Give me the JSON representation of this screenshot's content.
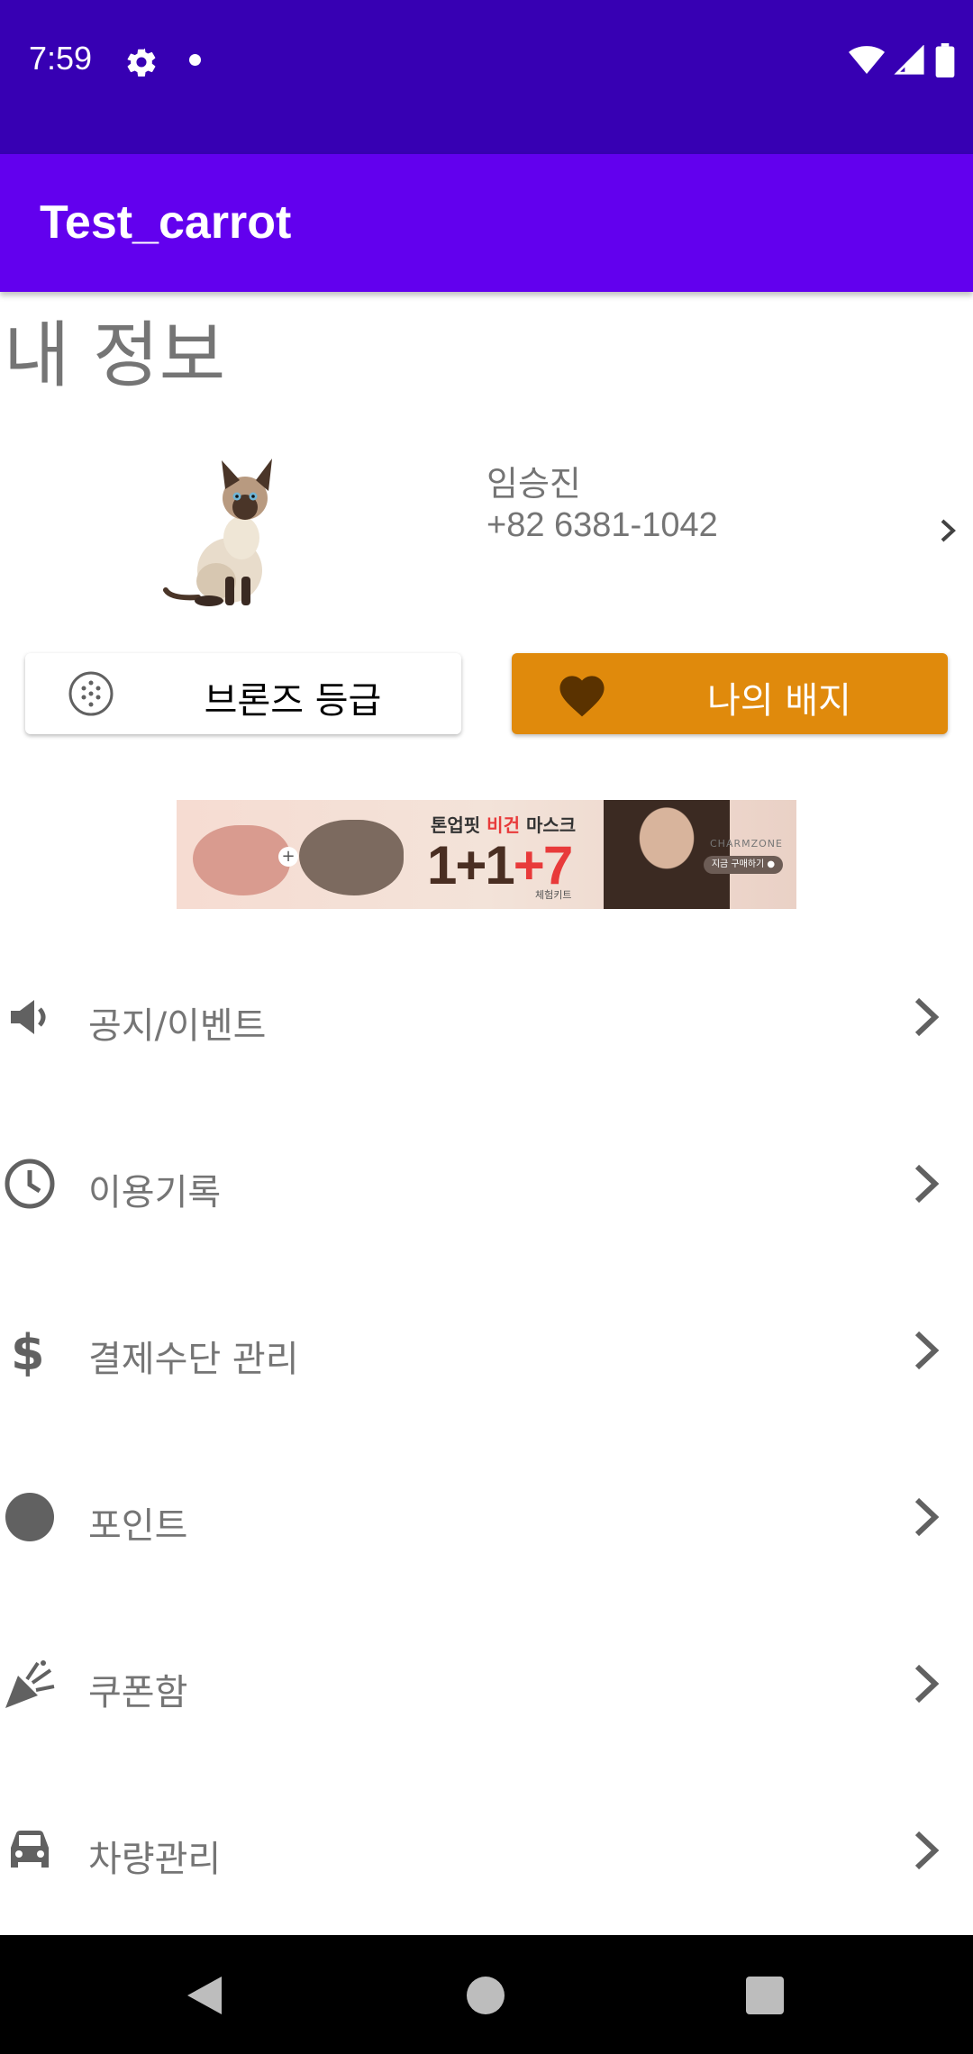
{
  "status_bar": {
    "time": "7:59",
    "icons": [
      "gear-icon",
      "notification-dot-icon",
      "wifi-icon",
      "signal-icon",
      "battery-icon"
    ]
  },
  "app_bar": {
    "title": "Test_carrot"
  },
  "page": {
    "title": "내 정보"
  },
  "profile": {
    "name": "임승진",
    "phone": "+82 6381-1042",
    "image": "cat-photo"
  },
  "actions": {
    "grade_label": "브론즈 등급",
    "badge_label": "나의 배지",
    "badge_color": "#e08a0c"
  },
  "ad": {
    "headline_part1": "톤업핏 ",
    "headline_accent": "비건",
    "headline_part2": " 마스크",
    "big_text": "1+1",
    "big_accent": "+7",
    "sub_text": "체험키트",
    "brand": "CHARMZONE",
    "cta": "지금 구매하기 ●"
  },
  "menu": {
    "items": [
      {
        "label": "공지/이벤트",
        "icon": "megaphone-icon"
      },
      {
        "label": "이용기록",
        "icon": "clock-icon"
      },
      {
        "label": "결제수단 관리",
        "icon": "dollar-icon"
      },
      {
        "label": "포인트",
        "icon": "circle-icon"
      },
      {
        "label": "쿠폰함",
        "icon": "party-popper-icon"
      },
      {
        "label": "차량관리",
        "icon": "car-icon"
      }
    ]
  },
  "colors": {
    "status_bar": "#3700b3",
    "app_bar": "#6200ee",
    "text_gray": "#757575"
  }
}
